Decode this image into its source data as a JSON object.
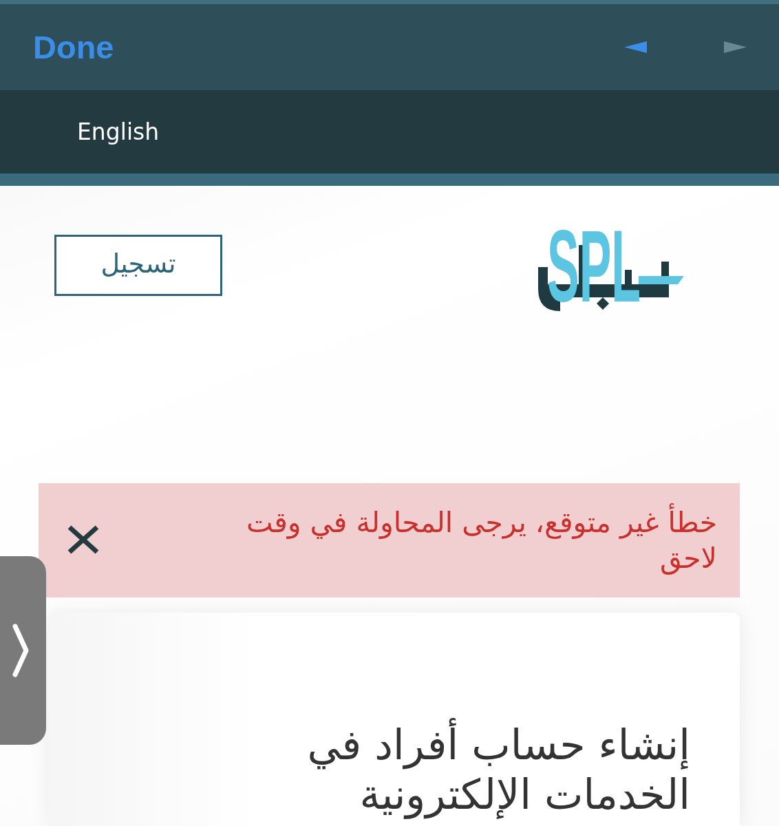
{
  "toolbar": {
    "done_label": "Done",
    "back": {
      "disabled": false
    },
    "forward": {
      "disabled": true
    }
  },
  "language_bar": {
    "link": "English"
  },
  "header": {
    "register_button": "تسجيل",
    "logo_text": "SPL"
  },
  "alert": {
    "message": "خطأ غير متوقع، يرجى المحاولة في وقت لاحق"
  },
  "card": {
    "title": "إنشاء حساب أفراد في الخدمات الإلكترونية"
  }
}
